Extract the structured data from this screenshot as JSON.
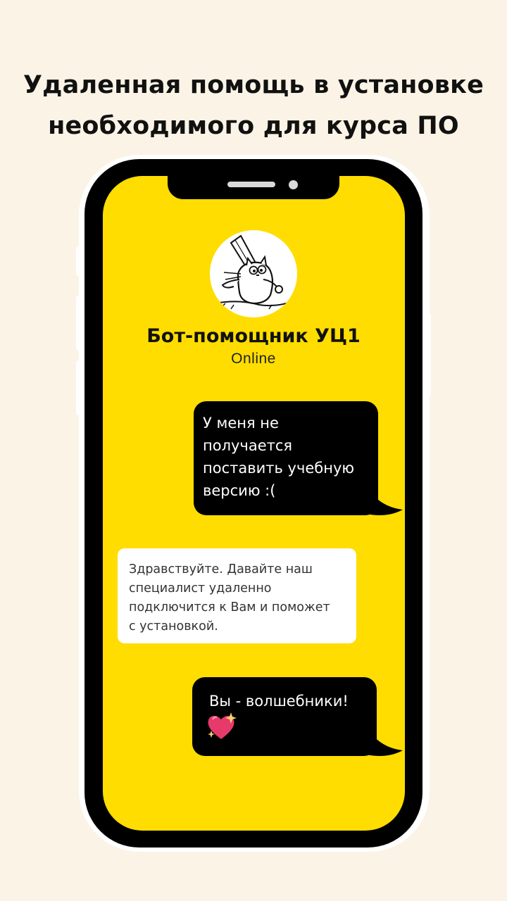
{
  "headline": {
    "line1": "Удаленная помощь в установке",
    "line2": "необходимого для курса ПО"
  },
  "chat": {
    "bot_name": "Бот-помощник УЦ1",
    "status": "Online",
    "messages": [
      {
        "from": "user",
        "text": "У меня не\nполучается\nпоставить учебную\nверсию :("
      },
      {
        "from": "bot",
        "text": "Здравствуйте. Давайте наш\nспециалист удаленно\nподключится к Вам и поможет\nс установкой."
      },
      {
        "from": "user",
        "text": "Вы - волшебники!",
        "emoji": "sparkling-heart"
      }
    ]
  },
  "colors": {
    "background": "#fbf4e6",
    "screen": "#ffdd00",
    "phone_frame": "#000000",
    "user_bubble": "#000000",
    "bot_bubble": "#ffffff",
    "heart": "#e63a6b"
  }
}
